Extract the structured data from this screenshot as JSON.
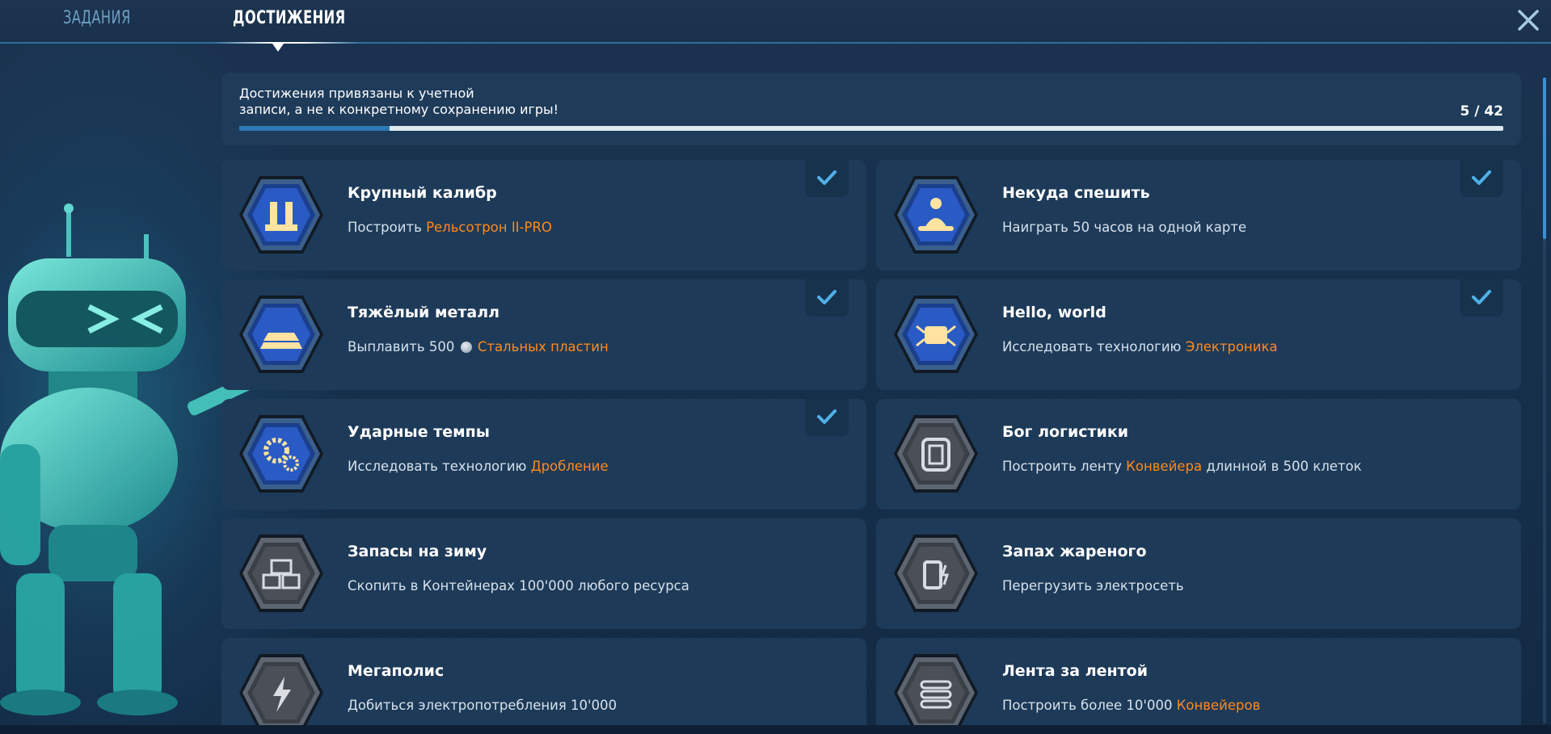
{
  "tabs": [
    {
      "label": "ЗАДАНИЯ",
      "active": false
    },
    {
      "label": "ДОСТИЖЕНИЯ",
      "active": true
    }
  ],
  "info": {
    "line1": "Достижения привязаны к учетной",
    "line2": "записи, а не к конкретному сохранению игры!",
    "count": "5 / 42",
    "progress_fraction": 0.119
  },
  "colors": {
    "highlight": "#ff8a1e",
    "check": "#4fb0e6",
    "background": "#16304c",
    "card": "#1d3a58"
  },
  "achievements": [
    {
      "title": "Крупный калибр",
      "pre": "Построить ",
      "link": "Рельсотрон II-PRO",
      "post": "",
      "done": true,
      "icon": "railgun-icon"
    },
    {
      "title": "Некуда спешить",
      "pre": "Наиграть 50 часов на одной карте",
      "link": "",
      "post": "",
      "done": true,
      "icon": "meditation-icon"
    },
    {
      "title": "Тяжёлый металл",
      "pre": "Выплавить 500 ",
      "link": "Стальных пластин",
      "post": "",
      "done": true,
      "icon": "metal-ingots-icon"
    },
    {
      "title": "Hello, world",
      "pre": "Исследовать технологию ",
      "link": "Электроника",
      "post": "",
      "done": true,
      "icon": "electronics-icon"
    },
    {
      "title": "Ударные темпы",
      "pre": "Исследовать технологию ",
      "link": "Дробление",
      "post": "",
      "done": true,
      "icon": "gears-icon"
    },
    {
      "title": "Бог логистики",
      "pre": "Построить ленту ",
      "link": "Конвейера",
      "post": " длинной в 500 клеток",
      "done": false,
      "icon": "conveyor-loop-icon"
    },
    {
      "title": "Запасы на зиму",
      "pre": "Скопить в Контейнерах 100'000 любого ресурса",
      "link": "",
      "post": "",
      "done": false,
      "icon": "containers-icon"
    },
    {
      "title": "Запах жареного",
      "pre": "Перегрузить электросеть",
      "link": "",
      "post": "",
      "done": false,
      "icon": "overload-icon"
    },
    {
      "title": "Мегаполис",
      "pre": "Добиться электропотребления 10'000",
      "link": "",
      "post": "",
      "done": false,
      "icon": "lightning-icon"
    },
    {
      "title": "Лента за лентой",
      "pre": "Построить более 10'000 ",
      "link": "Конвейеров",
      "post": "",
      "done": false,
      "icon": "conveyor-belts-icon"
    }
  ]
}
